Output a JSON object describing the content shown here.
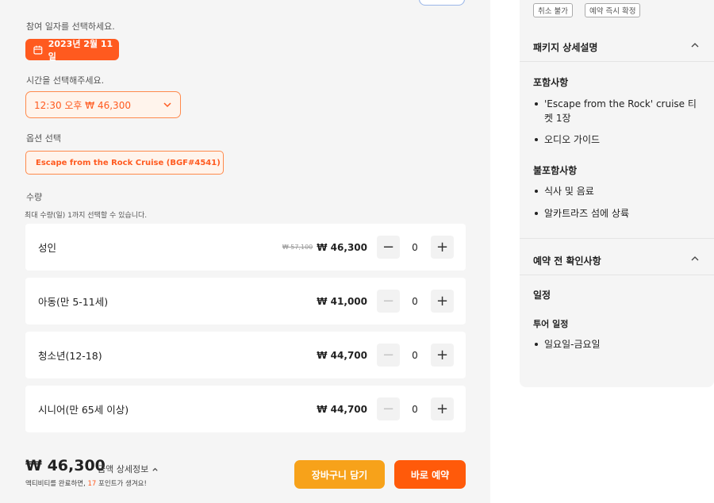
{
  "booking": {
    "date_label": "참여 일자를 선택하세요.",
    "date_value": "2023년 2월 11일",
    "time_label": "시간을 선택해주세요.",
    "time_value": "12:30 오후 ₩ 46,300",
    "option_label": "옵션 선택",
    "option_value": "Escape from the Rock Cruise (BGF#4541)",
    "qty_label": "수량",
    "qty_note": "최대 수량(일) 1까지 선택할 수 있습니다.",
    "tickets": [
      {
        "name": "성인",
        "original_price": "₩ 57,100",
        "price": "₩ 46,300",
        "qty": "0",
        "minus_enabled": true
      },
      {
        "name": "아동(만 5-11세)",
        "original_price": "",
        "price": "₩ 41,000",
        "qty": "0",
        "minus_enabled": false
      },
      {
        "name": "청소년(12-18)",
        "original_price": "",
        "price": "₩ 44,700",
        "qty": "0",
        "minus_enabled": false
      },
      {
        "name": "시니어(만 65세 이상)",
        "original_price": "",
        "price": "₩ 44,700",
        "qty": "0",
        "minus_enabled": false
      }
    ],
    "minus_symbol": "−",
    "plus_symbol": "+"
  },
  "footer": {
    "total": "₩ 46,300",
    "detail_link": "금액 상세정보",
    "points_prefix": "액티비티를 완료하면, ",
    "points_value": "17",
    "points_suffix": " 포인트가 생겨요!",
    "cart_button": "장바구니 담기",
    "book_button": "바로 예약"
  },
  "sidebar": {
    "tags": [
      "취소 불가",
      "예약 즉시 확정"
    ],
    "package_title": "패키지 상세설명",
    "included_title": "포함사항",
    "included_items": [
      "'Escape from the Rock' cruise 티켓 1장",
      "오디오 가이드"
    ],
    "excluded_title": "불포함사항",
    "excluded_items": [
      "식사 및 음료",
      "알카트라즈 섬에 상륙"
    ],
    "notice_title": "예약 전 확인사항",
    "schedule_title": "일정",
    "tour_schedule_title": "투어 일정",
    "schedule_items": [
      "일요일-금요일"
    ]
  },
  "colors": {
    "accent": "#ff5a1f",
    "cart": "#f7a21a",
    "panel_bg": "#f5f5f5"
  }
}
